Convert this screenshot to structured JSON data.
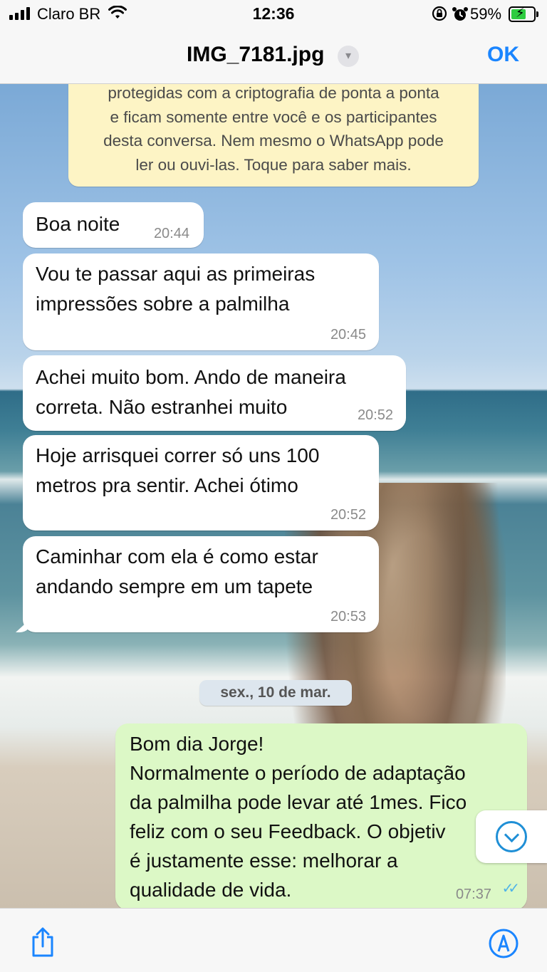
{
  "status_bar": {
    "carrier": "Claro BR",
    "time": "12:36",
    "battery_percent": "59%",
    "battery_level": 0.59,
    "icons": [
      "signal-bars-icon",
      "wifi-icon",
      "rotation-lock-icon",
      "alarm-icon",
      "battery-charging-icon"
    ]
  },
  "nav": {
    "title": "IMG_7181.jpg",
    "title_menu_icon": "chevron-down-icon",
    "ok_label": "OK",
    "accent_color": "#1a85ff"
  },
  "chat": {
    "encryption_notice": {
      "lines": [
        "protegidas com a criptografia de ponta a ponta",
        "e ficam somente entre você e os participantes",
        "desta conversa. Nem mesmo o WhatsApp pode",
        "ler ou ouvi-las. Toque para saber mais."
      ]
    },
    "incoming": [
      {
        "lines": [
          "Boa noite"
        ],
        "time": "20:44"
      },
      {
        "lines": [
          "Vou te passar aqui as primeiras",
          "impressões sobre a palmilha"
        ],
        "time": "20:45"
      },
      {
        "lines": [
          "Achei muito bom. Ando de maneira",
          "correta. Não estranhei muito"
        ],
        "time": "20:52"
      },
      {
        "lines": [
          "Hoje arrisquei correr só uns 100",
          "metros pra sentir. Achei ótimo"
        ],
        "time": "20:52"
      },
      {
        "lines": [
          "Caminhar com ela é como estar",
          "andando sempre em um tapete"
        ],
        "time": "20:53"
      }
    ],
    "date_separator": "sex., 10 de mar.",
    "outgoing": {
      "lines": [
        "Bom dia Jorge!",
        "Normalmente o período de adaptação",
        "da palmilha pode levar até 1mes. Fico",
        "feliz com o seu Feedback. O objetiv",
        "é justamente esse: melhorar a",
        "qualidade de vida."
      ],
      "time": "07:37",
      "read_status_icon": "double-check-icon"
    },
    "scroll_button_icon": "chevron-down-circle-icon",
    "colors": {
      "incoming_bubble": "#ffffff",
      "outgoing_bubble": "#dcf8c6",
      "notice_bubble": "#fdf4c5",
      "read_ticks": "#4fb3e8"
    }
  },
  "toolbar": {
    "left_icon": "share-icon",
    "right_icon": "markup-pen-icon"
  }
}
